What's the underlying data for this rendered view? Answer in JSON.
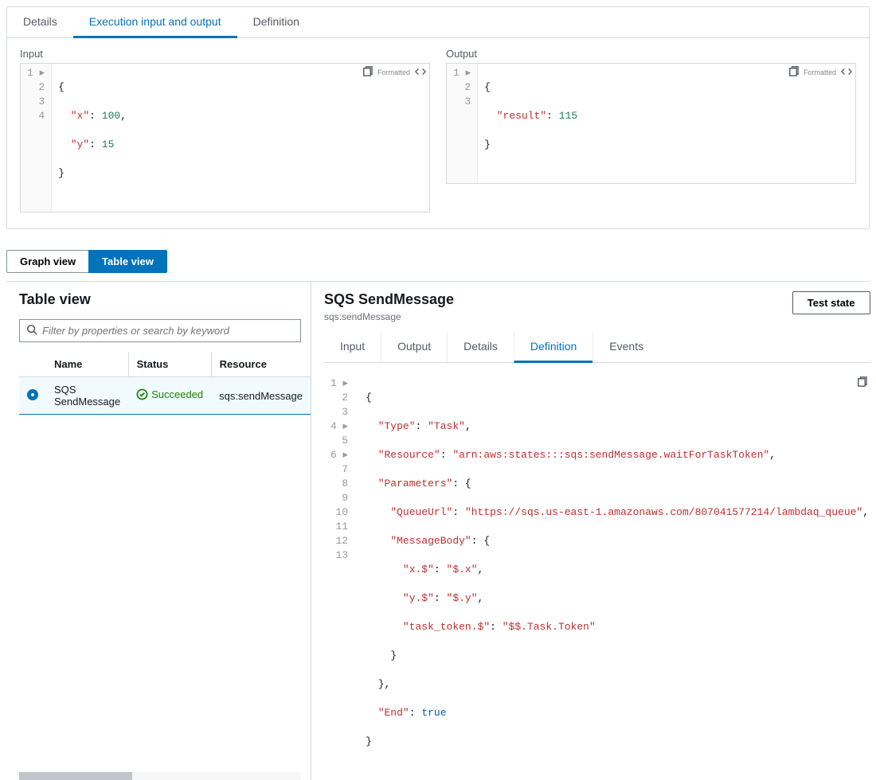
{
  "topTabs": {
    "details": "Details",
    "io": "Execution input and output",
    "definition": "Definition"
  },
  "input": {
    "label": "Input",
    "badge": "Formatted",
    "code": {
      "l1": "{",
      "l2a": "\"x\"",
      "l2b": ": ",
      "l2c": "100",
      "l2d": ",",
      "l3a": "\"y\"",
      "l3b": ": ",
      "l3c": "15",
      "l4": "}"
    }
  },
  "output": {
    "label": "Output",
    "badge": "Formatted",
    "code": {
      "l1": "{",
      "l2a": "\"result\"",
      "l2b": ": ",
      "l2c": "115",
      "l3": "}"
    }
  },
  "viewToggle": {
    "graph": "Graph view",
    "table": "Table view"
  },
  "tableView": {
    "title": "Table view",
    "searchPlaceholder": "Filter by properties or search by keyword",
    "cols": {
      "name": "Name",
      "status": "Status",
      "resource": "Resource"
    },
    "row": {
      "name": "SQS SendMessage",
      "status": "Succeeded",
      "resource": "sqs:sendMessage"
    }
  },
  "detail": {
    "title": "SQS SendMessage",
    "subtitle": "sqs:sendMessage",
    "testBtn": "Test state",
    "tabs": {
      "input": "Input",
      "output": "Output",
      "details": "Details",
      "definition": "Definition",
      "events": "Events"
    },
    "def": {
      "l1": "{",
      "l2k": "\"Type\"",
      "l2v": "\"Task\"",
      "l3k": "\"Resource\"",
      "l3v": "\"arn:aws:states:::sqs:sendMessage.waitForTaskToken\"",
      "l4k": "\"Parameters\"",
      "l5k": "\"QueueUrl\"",
      "l5v": "\"https://sqs.us-east-1.amazonaws.com/807041577214/lambdaq_queue\"",
      "l6k": "\"MessageBody\"",
      "l7k": "\"x.$\"",
      "l7v": "\"$.x\"",
      "l8k": "\"y.$\"",
      "l8v": "\"$.y\"",
      "l9k": "\"task_token.$\"",
      "l9v": "\"$$.Task.Token\"",
      "l10": "    }",
      "l11": "  },",
      "l12k": "\"End\"",
      "l12v": "true",
      "l13": "}"
    }
  }
}
